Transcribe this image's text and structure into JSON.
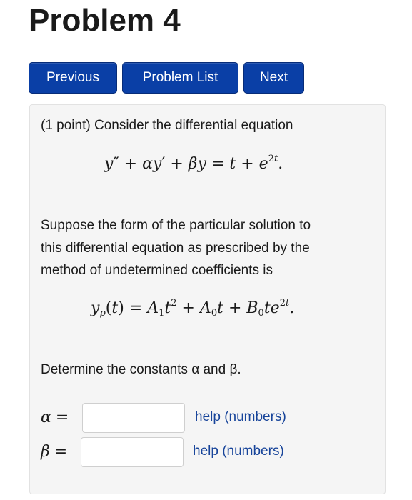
{
  "page": {
    "title": "Problem 4"
  },
  "nav": {
    "previous_label": "Previous",
    "problem_list_label": "Problem List",
    "next_label": "Next"
  },
  "problem": {
    "intro": "(1 point) Consider the differential equation",
    "suppose_line1": "Suppose the form of the particular solution to",
    "suppose_line2": "this differential equation as prescribed by the",
    "suppose_line3": "method of undetermined coefficients is",
    "determine_text": "Determine the constants α and β."
  },
  "answers": [
    {
      "label": "α",
      "value": "",
      "placeholder": "",
      "help_label": "help (numbers)"
    },
    {
      "label": "β",
      "value": "",
      "placeholder": "",
      "help_label": "help (numbers)"
    }
  ],
  "colors": {
    "button_bg": "#0a3fa6",
    "link": "#17449a",
    "panel_bg": "#f5f5f5"
  }
}
